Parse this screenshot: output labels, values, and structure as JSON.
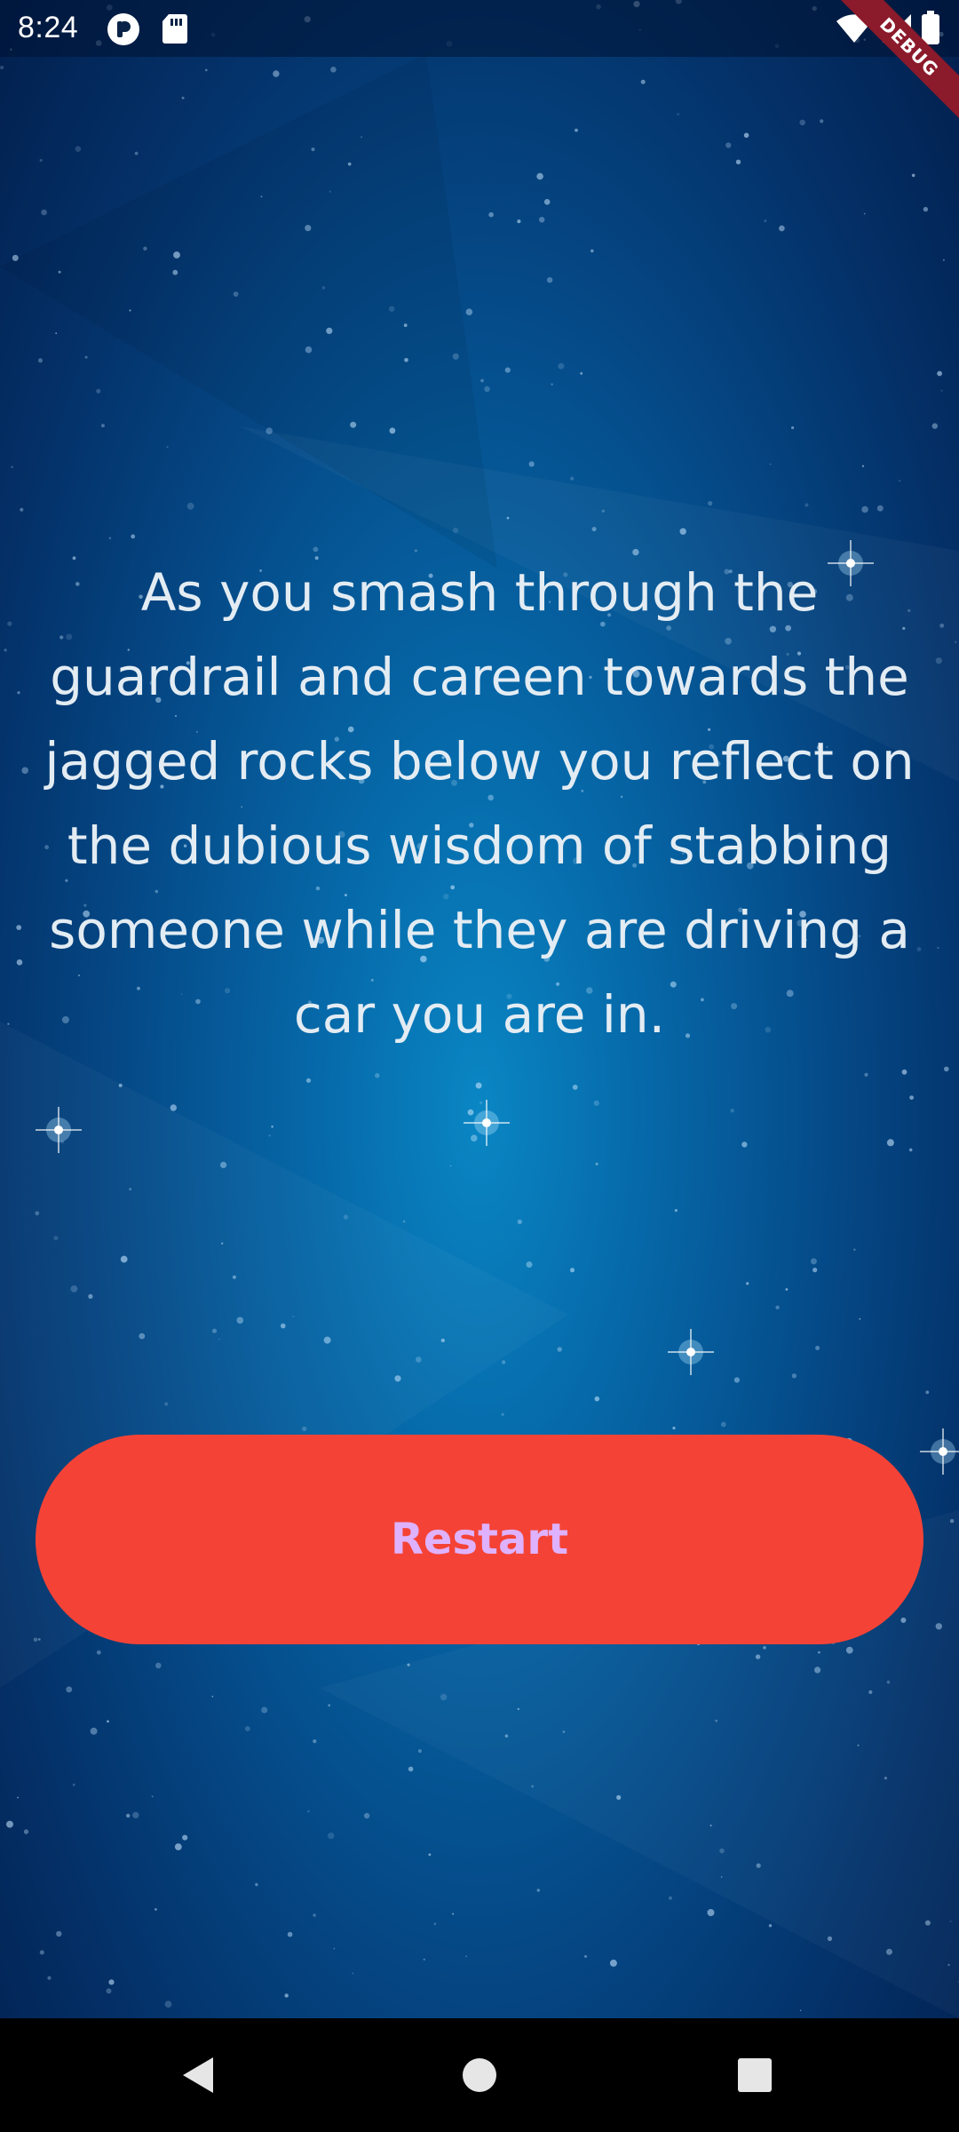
{
  "status_bar": {
    "time": "8:24",
    "left_icons": [
      "app-notification-icon",
      "sd-card-icon"
    ],
    "right_icons": [
      "wifi-icon",
      "signal-icon",
      "battery-icon"
    ]
  },
  "debug_banner": {
    "label": "DEBUG",
    "color": "#8b1a2a"
  },
  "story": {
    "text": "As you smash through the guardrail and careen towards the jagged rocks below you reflect on the dubious wisdom of stabbing someone while they are driving a car you are in."
  },
  "restart_button": {
    "label": "Restart",
    "background_color": "#f44336",
    "text_color": "#dfb2ff"
  },
  "nav_bar": {
    "buttons": [
      "back-icon",
      "home-icon",
      "recents-icon"
    ]
  },
  "colors": {
    "background_top": "#021f4d",
    "background_center": "#0a86c4"
  }
}
